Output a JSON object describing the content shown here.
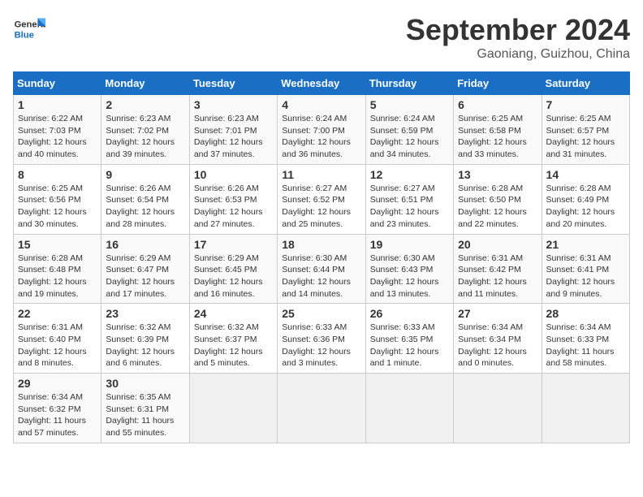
{
  "header": {
    "logo_general": "General",
    "logo_blue": "Blue",
    "month_title": "September 2024",
    "location": "Gaoniang, Guizhou, China"
  },
  "columns": [
    "Sunday",
    "Monday",
    "Tuesday",
    "Wednesday",
    "Thursday",
    "Friday",
    "Saturday"
  ],
  "weeks": [
    [
      {
        "day": "1",
        "info": "Sunrise: 6:22 AM\nSunset: 7:03 PM\nDaylight: 12 hours\nand 40 minutes."
      },
      {
        "day": "2",
        "info": "Sunrise: 6:23 AM\nSunset: 7:02 PM\nDaylight: 12 hours\nand 39 minutes."
      },
      {
        "day": "3",
        "info": "Sunrise: 6:23 AM\nSunset: 7:01 PM\nDaylight: 12 hours\nand 37 minutes."
      },
      {
        "day": "4",
        "info": "Sunrise: 6:24 AM\nSunset: 7:00 PM\nDaylight: 12 hours\nand 36 minutes."
      },
      {
        "day": "5",
        "info": "Sunrise: 6:24 AM\nSunset: 6:59 PM\nDaylight: 12 hours\nand 34 minutes."
      },
      {
        "day": "6",
        "info": "Sunrise: 6:25 AM\nSunset: 6:58 PM\nDaylight: 12 hours\nand 33 minutes."
      },
      {
        "day": "7",
        "info": "Sunrise: 6:25 AM\nSunset: 6:57 PM\nDaylight: 12 hours\nand 31 minutes."
      }
    ],
    [
      {
        "day": "8",
        "info": "Sunrise: 6:25 AM\nSunset: 6:56 PM\nDaylight: 12 hours\nand 30 minutes."
      },
      {
        "day": "9",
        "info": "Sunrise: 6:26 AM\nSunset: 6:54 PM\nDaylight: 12 hours\nand 28 minutes."
      },
      {
        "day": "10",
        "info": "Sunrise: 6:26 AM\nSunset: 6:53 PM\nDaylight: 12 hours\nand 27 minutes."
      },
      {
        "day": "11",
        "info": "Sunrise: 6:27 AM\nSunset: 6:52 PM\nDaylight: 12 hours\nand 25 minutes."
      },
      {
        "day": "12",
        "info": "Sunrise: 6:27 AM\nSunset: 6:51 PM\nDaylight: 12 hours\nand 23 minutes."
      },
      {
        "day": "13",
        "info": "Sunrise: 6:28 AM\nSunset: 6:50 PM\nDaylight: 12 hours\nand 22 minutes."
      },
      {
        "day": "14",
        "info": "Sunrise: 6:28 AM\nSunset: 6:49 PM\nDaylight: 12 hours\nand 20 minutes."
      }
    ],
    [
      {
        "day": "15",
        "info": "Sunrise: 6:28 AM\nSunset: 6:48 PM\nDaylight: 12 hours\nand 19 minutes."
      },
      {
        "day": "16",
        "info": "Sunrise: 6:29 AM\nSunset: 6:47 PM\nDaylight: 12 hours\nand 17 minutes."
      },
      {
        "day": "17",
        "info": "Sunrise: 6:29 AM\nSunset: 6:45 PM\nDaylight: 12 hours\nand 16 minutes."
      },
      {
        "day": "18",
        "info": "Sunrise: 6:30 AM\nSunset: 6:44 PM\nDaylight: 12 hours\nand 14 minutes."
      },
      {
        "day": "19",
        "info": "Sunrise: 6:30 AM\nSunset: 6:43 PM\nDaylight: 12 hours\nand 13 minutes."
      },
      {
        "day": "20",
        "info": "Sunrise: 6:31 AM\nSunset: 6:42 PM\nDaylight: 12 hours\nand 11 minutes."
      },
      {
        "day": "21",
        "info": "Sunrise: 6:31 AM\nSunset: 6:41 PM\nDaylight: 12 hours\nand 9 minutes."
      }
    ],
    [
      {
        "day": "22",
        "info": "Sunrise: 6:31 AM\nSunset: 6:40 PM\nDaylight: 12 hours\nand 8 minutes."
      },
      {
        "day": "23",
        "info": "Sunrise: 6:32 AM\nSunset: 6:39 PM\nDaylight: 12 hours\nand 6 minutes."
      },
      {
        "day": "24",
        "info": "Sunrise: 6:32 AM\nSunset: 6:37 PM\nDaylight: 12 hours\nand 5 minutes."
      },
      {
        "day": "25",
        "info": "Sunrise: 6:33 AM\nSunset: 6:36 PM\nDaylight: 12 hours\nand 3 minutes."
      },
      {
        "day": "26",
        "info": "Sunrise: 6:33 AM\nSunset: 6:35 PM\nDaylight: 12 hours\nand 1 minute."
      },
      {
        "day": "27",
        "info": "Sunrise: 6:34 AM\nSunset: 6:34 PM\nDaylight: 12 hours\nand 0 minutes."
      },
      {
        "day": "28",
        "info": "Sunrise: 6:34 AM\nSunset: 6:33 PM\nDaylight: 11 hours\nand 58 minutes."
      }
    ],
    [
      {
        "day": "29",
        "info": "Sunrise: 6:34 AM\nSunset: 6:32 PM\nDaylight: 11 hours\nand 57 minutes."
      },
      {
        "day": "30",
        "info": "Sunrise: 6:35 AM\nSunset: 6:31 PM\nDaylight: 11 hours\nand 55 minutes."
      },
      {
        "day": "",
        "info": ""
      },
      {
        "day": "",
        "info": ""
      },
      {
        "day": "",
        "info": ""
      },
      {
        "day": "",
        "info": ""
      },
      {
        "day": "",
        "info": ""
      }
    ]
  ]
}
